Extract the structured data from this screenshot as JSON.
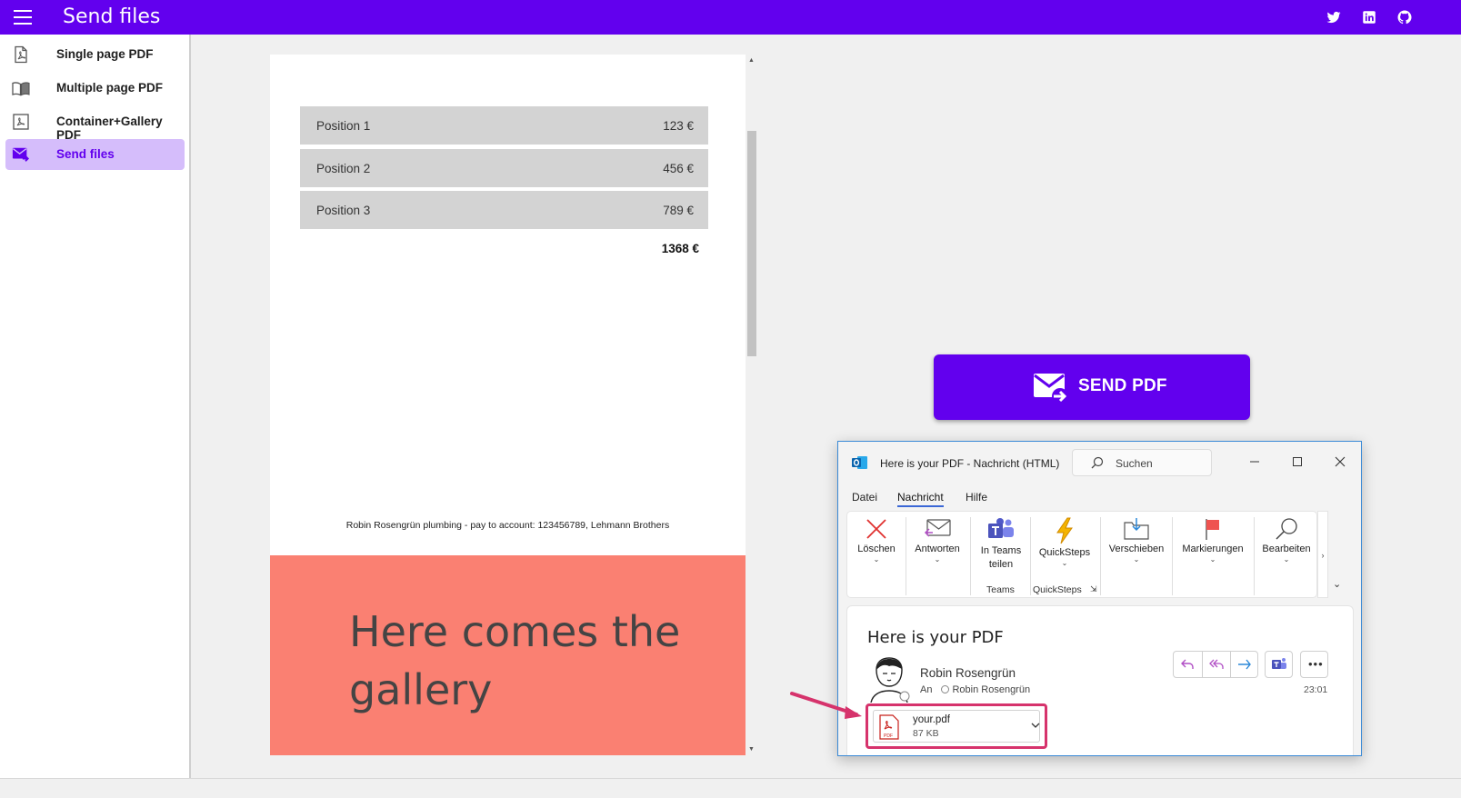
{
  "app": {
    "title": "Send files"
  },
  "topbar": {
    "icons": [
      "menu-icon",
      "twitter-icon",
      "linkedin-icon",
      "github-icon"
    ]
  },
  "sidebar": {
    "items": [
      {
        "label": "Single page PDF",
        "icon": "pdf-file-icon",
        "active": false
      },
      {
        "label": "Multiple page PDF",
        "icon": "book-icon",
        "active": false
      },
      {
        "label": "Container+Gallery PDF",
        "icon": "pdf-frame-icon",
        "active": false
      },
      {
        "label": "Send files",
        "icon": "mail-send-icon",
        "active": true
      }
    ]
  },
  "pdf_preview": {
    "positions": [
      {
        "name": "Position 1",
        "value": "123 €"
      },
      {
        "name": "Position 2",
        "value": "456 €"
      },
      {
        "name": "Position 3",
        "value": "789 €"
      }
    ],
    "total": "1368 €",
    "footer": "Robin Rosengrün plumbing - pay to account: 123456789, Lehmann Brothers",
    "gallery_text": "Here comes the gallery"
  },
  "send_button": {
    "label": "SEND PDF"
  },
  "outlook": {
    "window_title": "Here is your PDF  -  Nachricht (HTML)",
    "search_placeholder": "Suchen",
    "tabs": [
      "Datei",
      "Nachricht",
      "Hilfe"
    ],
    "active_tab": "Nachricht",
    "ribbon": {
      "delete": "Löschen",
      "reply": "Antworten",
      "teams_line1": "In Teams",
      "teams_line2": "teilen",
      "quicksteps": "QuickSteps",
      "move": "Verschieben",
      "flags": "Markierungen",
      "edit": "Bearbeiten",
      "group_teams": "Teams",
      "group_quicksteps": "QuickSteps"
    },
    "message": {
      "subject": "Here is your PDF",
      "sender": "Robin Rosengrün",
      "to_label": "An",
      "to_name": "Robin Rosengrün",
      "time": "23:01",
      "attachment_name": "your.pdf",
      "attachment_size": "87 KB"
    }
  },
  "colors": {
    "primary": "#6200ee",
    "active_nav_bg": "#d5bdfb",
    "gallery_bg": "#fa8072",
    "callout": "#d6336c",
    "outlook_blue": "#3b67d6"
  }
}
